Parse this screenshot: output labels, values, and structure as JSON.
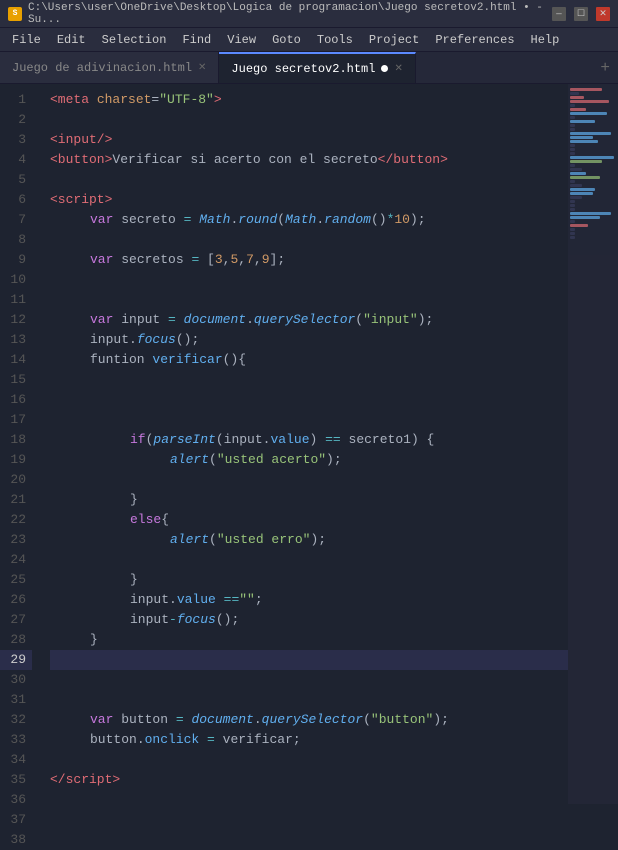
{
  "titlebar": {
    "icon_label": "S",
    "title": "C:\\Users\\user\\OneDrive\\Desktop\\Logica de programacion\\Juego secretov2.html • - Su...",
    "controls": [
      "minimize",
      "maximize",
      "close"
    ]
  },
  "menubar": {
    "items": [
      "File",
      "Edit",
      "Selection",
      "Find",
      "View",
      "Goto",
      "Tools",
      "Project",
      "Preferences",
      "Help"
    ]
  },
  "tabs": [
    {
      "label": "Juego de adivinacion.html",
      "active": false
    },
    {
      "label": "Juego secretov2.html",
      "active": true
    }
  ],
  "tab_add_label": "+",
  "code_lines": [
    {
      "num": 1,
      "content": "meta_charset"
    },
    {
      "num": 2,
      "content": "blank"
    },
    {
      "num": 3,
      "content": "input_tag"
    },
    {
      "num": 4,
      "content": "button_tag"
    },
    {
      "num": 5,
      "content": "blank"
    },
    {
      "num": 6,
      "content": "script_open"
    },
    {
      "num": 7,
      "content": "var_secreto"
    },
    {
      "num": 8,
      "content": "blank"
    },
    {
      "num": 9,
      "content": "var_secretos"
    },
    {
      "num": 10,
      "content": "blank"
    },
    {
      "num": 11,
      "content": "blank"
    },
    {
      "num": 12,
      "content": "var_input"
    },
    {
      "num": 13,
      "content": "input_focus"
    },
    {
      "num": 14,
      "content": "funtion_verificar"
    },
    {
      "num": 15,
      "content": "blank"
    },
    {
      "num": 16,
      "content": "blank"
    },
    {
      "num": 17,
      "content": "blank"
    },
    {
      "num": 18,
      "content": "if_parseInt"
    },
    {
      "num": 19,
      "content": "alert_acerto"
    },
    {
      "num": 20,
      "content": "blank"
    },
    {
      "num": 21,
      "content": "close_brace"
    },
    {
      "num": 22,
      "content": "else_brace"
    },
    {
      "num": 23,
      "content": "alert_erro"
    },
    {
      "num": 24,
      "content": "blank"
    },
    {
      "num": 25,
      "content": "close_brace2"
    },
    {
      "num": 26,
      "content": "input_value"
    },
    {
      "num": 27,
      "content": "input_focus2"
    },
    {
      "num": 28,
      "content": "close_brace3"
    },
    {
      "num": 29,
      "content": "blank_active"
    },
    {
      "num": 30,
      "content": "blank"
    },
    {
      "num": 31,
      "content": "blank"
    },
    {
      "num": 32,
      "content": "var_button"
    },
    {
      "num": 33,
      "content": "button_onclick"
    },
    {
      "num": 34,
      "content": "blank"
    },
    {
      "num": 35,
      "content": "script_close"
    },
    {
      "num": 36,
      "content": "blank"
    },
    {
      "num": 37,
      "content": "blank"
    },
    {
      "num": 38,
      "content": "blank"
    }
  ]
}
